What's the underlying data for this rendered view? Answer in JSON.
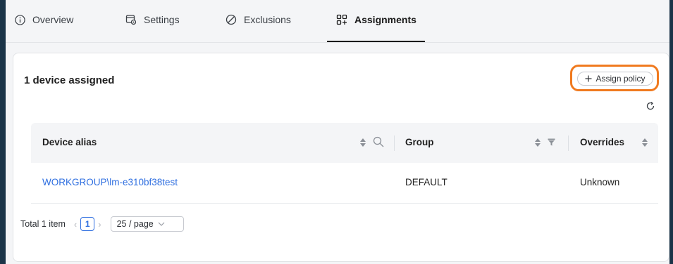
{
  "tabs": [
    {
      "label": "Overview",
      "icon": "info-icon"
    },
    {
      "label": "Settings",
      "icon": "settings-icon"
    },
    {
      "label": "Exclusions",
      "icon": "exclusion-icon"
    },
    {
      "label": "Assignments",
      "icon": "assignments-icon"
    }
  ],
  "card": {
    "title": "1 device assigned",
    "assign_label": "Assign policy",
    "highlight_color": "#f07a1f"
  },
  "table": {
    "columns": [
      "Device alias",
      "Group",
      "Overrides"
    ],
    "rows": [
      {
        "device_alias": "WORKGROUP\\lm-e310bf38test",
        "group": "DEFAULT",
        "overrides": "Unknown"
      }
    ]
  },
  "pager": {
    "total": "Total 1 item",
    "current_page": "1",
    "page_size": "25 / page"
  },
  "colors": {
    "accent": "#2f6fe0",
    "background": "#1b3448"
  }
}
